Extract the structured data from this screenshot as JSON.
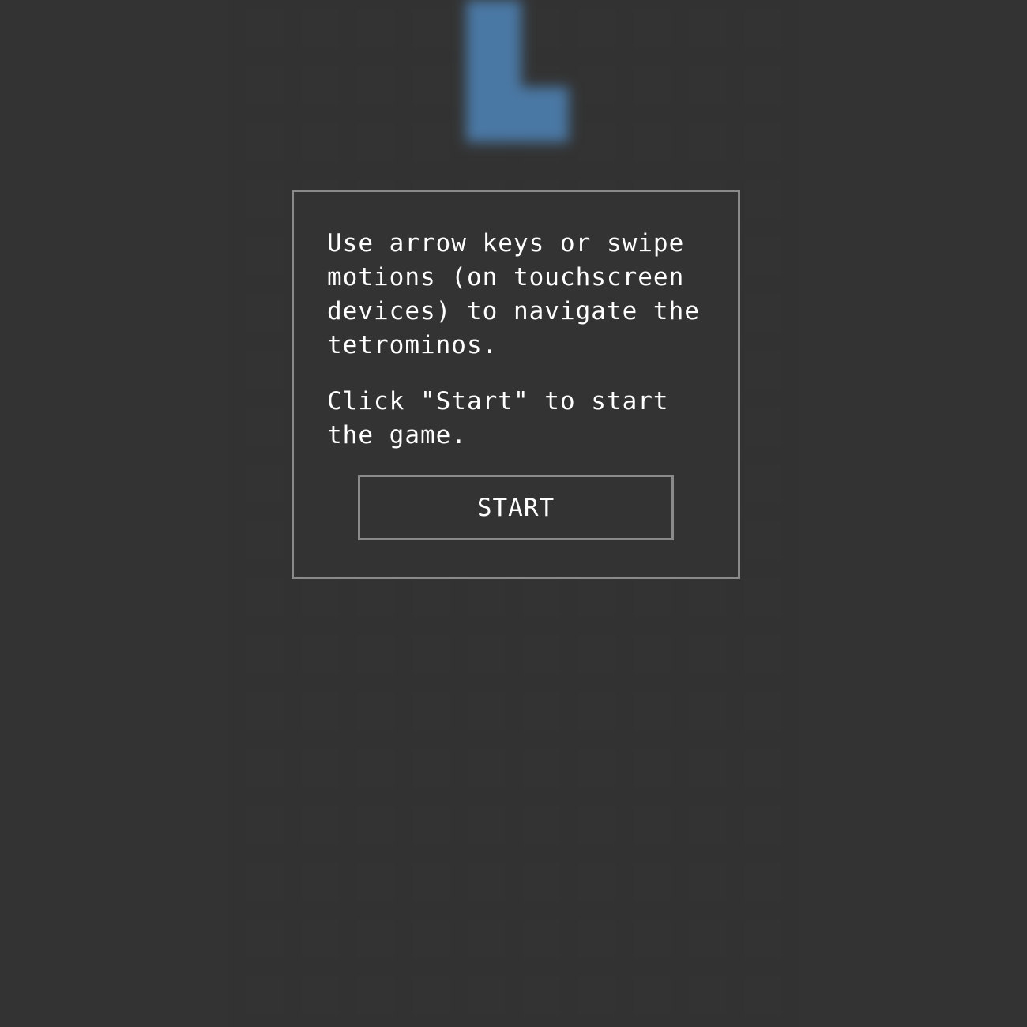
{
  "game": {
    "background_color": "#333333",
    "falling_piece": {
      "shape": "L",
      "color": "#4a78a4"
    }
  },
  "modal": {
    "instructions": "Use arrow keys or swipe motions (on touchscreen devices) to navigate the tetrominos.",
    "start_hint": "Click \"Start\" to start the game.",
    "start_label": "START",
    "border_color": "#8a8a8a"
  }
}
